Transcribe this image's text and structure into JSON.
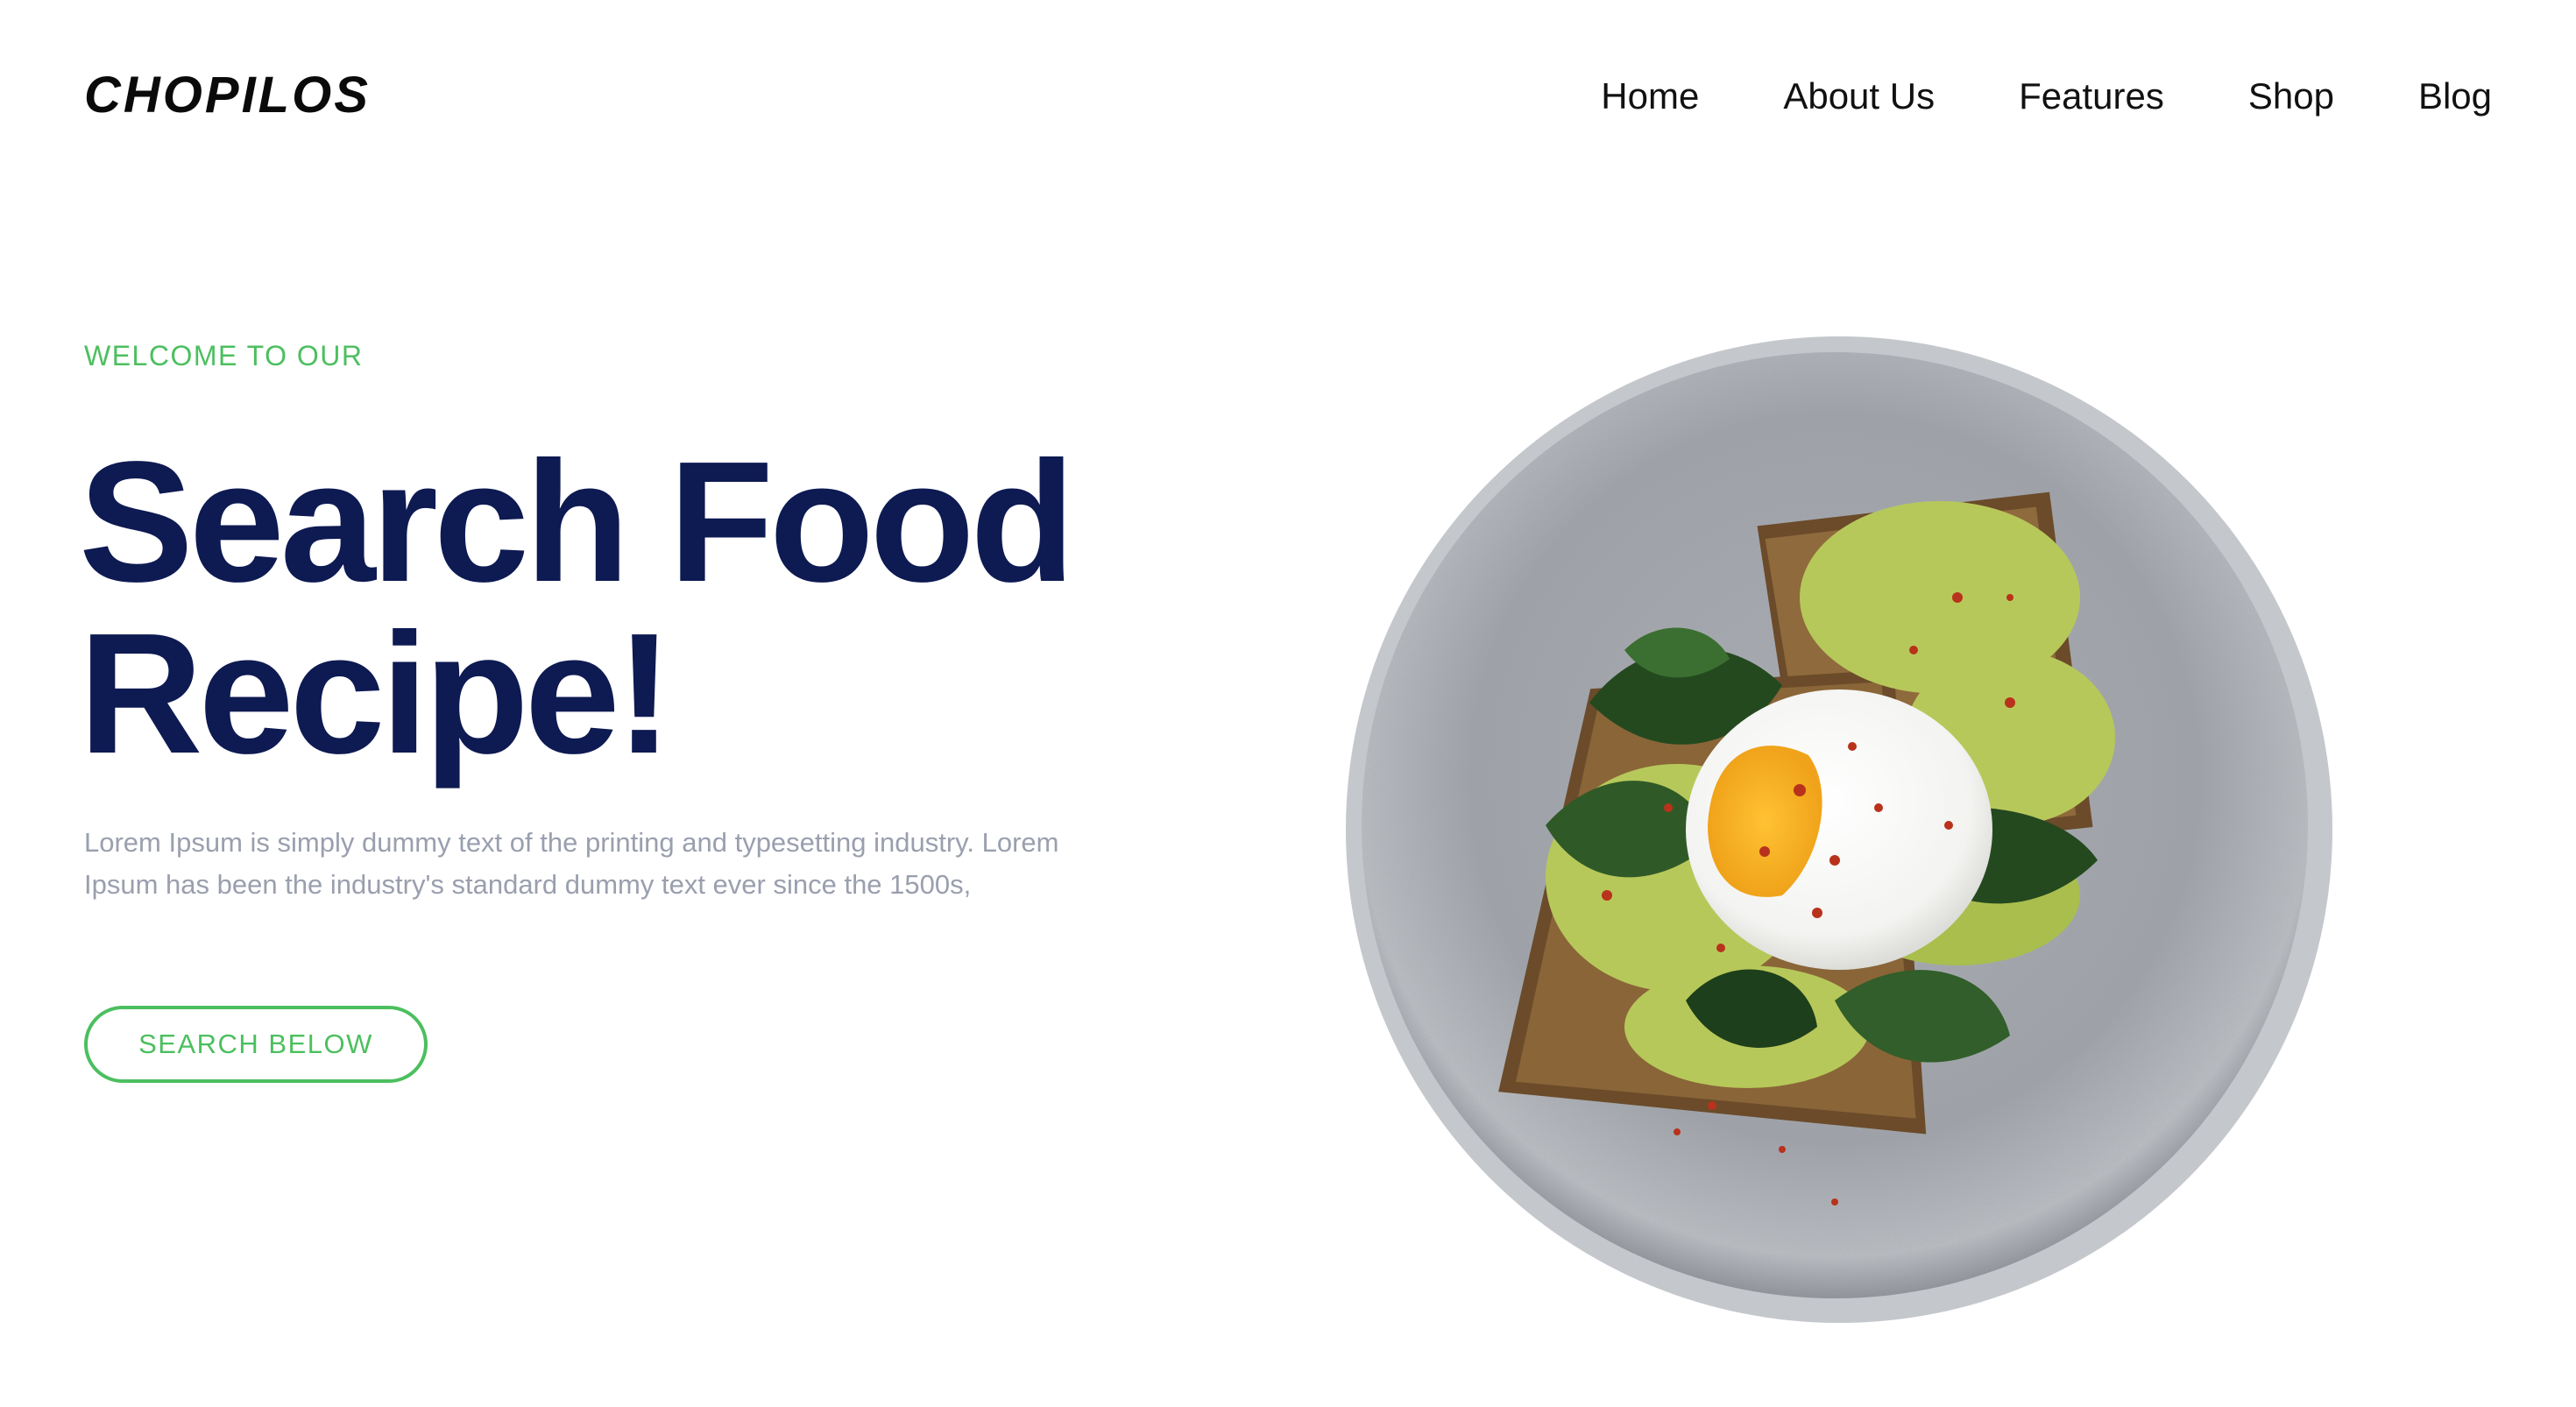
{
  "header": {
    "logo": "CHOPILOS",
    "nav": [
      {
        "label": "Home"
      },
      {
        "label": "About Us"
      },
      {
        "label": "Features"
      },
      {
        "label": "Shop"
      },
      {
        "label": "Blog"
      }
    ]
  },
  "hero": {
    "eyebrow": "WELCOME TO OUR",
    "title_line1": "Search Food",
    "title_line2": "Recipe!",
    "description": "Lorem Ipsum is simply dummy text of the printing and typesetting industry. Lorem Ipsum has been the industry's standard dummy text ever since the 1500s,",
    "cta_label": "SEARCH BELOW"
  },
  "image": {
    "subject": "avocado-toast-with-poached-egg-on-gray-plate"
  },
  "colors": {
    "accent_green": "#4cbf5f",
    "headline_navy": "#0e1a52",
    "body_gray": "#9a9fae",
    "nav_text": "#111111"
  }
}
